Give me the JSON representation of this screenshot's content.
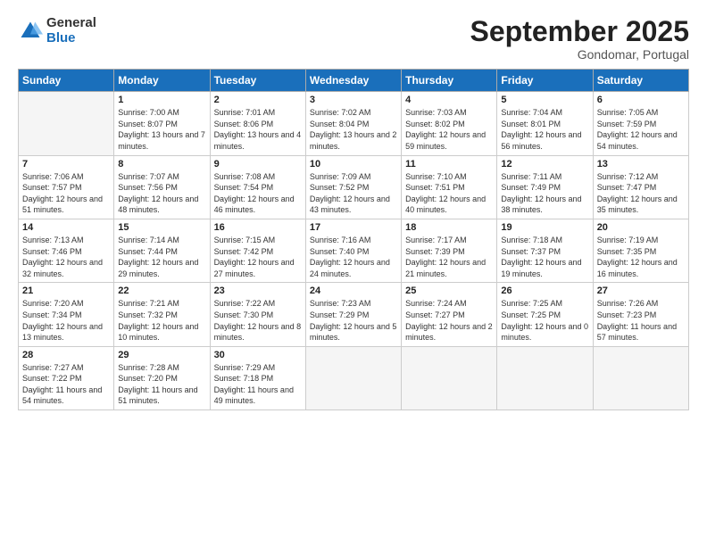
{
  "logo": {
    "general": "General",
    "blue": "Blue"
  },
  "title": "September 2025",
  "location": "Gondomar, Portugal",
  "days_of_week": [
    "Sunday",
    "Monday",
    "Tuesday",
    "Wednesday",
    "Thursday",
    "Friday",
    "Saturday"
  ],
  "weeks": [
    [
      {
        "day": "",
        "info": ""
      },
      {
        "day": "1",
        "info": "Sunrise: 7:00 AM\nSunset: 8:07 PM\nDaylight: 13 hours and 7 minutes."
      },
      {
        "day": "2",
        "info": "Sunrise: 7:01 AM\nSunset: 8:06 PM\nDaylight: 13 hours and 4 minutes."
      },
      {
        "day": "3",
        "info": "Sunrise: 7:02 AM\nSunset: 8:04 PM\nDaylight: 13 hours and 2 minutes."
      },
      {
        "day": "4",
        "info": "Sunrise: 7:03 AM\nSunset: 8:02 PM\nDaylight: 12 hours and 59 minutes."
      },
      {
        "day": "5",
        "info": "Sunrise: 7:04 AM\nSunset: 8:01 PM\nDaylight: 12 hours and 56 minutes."
      },
      {
        "day": "6",
        "info": "Sunrise: 7:05 AM\nSunset: 7:59 PM\nDaylight: 12 hours and 54 minutes."
      }
    ],
    [
      {
        "day": "7",
        "info": "Sunrise: 7:06 AM\nSunset: 7:57 PM\nDaylight: 12 hours and 51 minutes."
      },
      {
        "day": "8",
        "info": "Sunrise: 7:07 AM\nSunset: 7:56 PM\nDaylight: 12 hours and 48 minutes."
      },
      {
        "day": "9",
        "info": "Sunrise: 7:08 AM\nSunset: 7:54 PM\nDaylight: 12 hours and 46 minutes."
      },
      {
        "day": "10",
        "info": "Sunrise: 7:09 AM\nSunset: 7:52 PM\nDaylight: 12 hours and 43 minutes."
      },
      {
        "day": "11",
        "info": "Sunrise: 7:10 AM\nSunset: 7:51 PM\nDaylight: 12 hours and 40 minutes."
      },
      {
        "day": "12",
        "info": "Sunrise: 7:11 AM\nSunset: 7:49 PM\nDaylight: 12 hours and 38 minutes."
      },
      {
        "day": "13",
        "info": "Sunrise: 7:12 AM\nSunset: 7:47 PM\nDaylight: 12 hours and 35 minutes."
      }
    ],
    [
      {
        "day": "14",
        "info": "Sunrise: 7:13 AM\nSunset: 7:46 PM\nDaylight: 12 hours and 32 minutes."
      },
      {
        "day": "15",
        "info": "Sunrise: 7:14 AM\nSunset: 7:44 PM\nDaylight: 12 hours and 29 minutes."
      },
      {
        "day": "16",
        "info": "Sunrise: 7:15 AM\nSunset: 7:42 PM\nDaylight: 12 hours and 27 minutes."
      },
      {
        "day": "17",
        "info": "Sunrise: 7:16 AM\nSunset: 7:40 PM\nDaylight: 12 hours and 24 minutes."
      },
      {
        "day": "18",
        "info": "Sunrise: 7:17 AM\nSunset: 7:39 PM\nDaylight: 12 hours and 21 minutes."
      },
      {
        "day": "19",
        "info": "Sunrise: 7:18 AM\nSunset: 7:37 PM\nDaylight: 12 hours and 19 minutes."
      },
      {
        "day": "20",
        "info": "Sunrise: 7:19 AM\nSunset: 7:35 PM\nDaylight: 12 hours and 16 minutes."
      }
    ],
    [
      {
        "day": "21",
        "info": "Sunrise: 7:20 AM\nSunset: 7:34 PM\nDaylight: 12 hours and 13 minutes."
      },
      {
        "day": "22",
        "info": "Sunrise: 7:21 AM\nSunset: 7:32 PM\nDaylight: 12 hours and 10 minutes."
      },
      {
        "day": "23",
        "info": "Sunrise: 7:22 AM\nSunset: 7:30 PM\nDaylight: 12 hours and 8 minutes."
      },
      {
        "day": "24",
        "info": "Sunrise: 7:23 AM\nSunset: 7:29 PM\nDaylight: 12 hours and 5 minutes."
      },
      {
        "day": "25",
        "info": "Sunrise: 7:24 AM\nSunset: 7:27 PM\nDaylight: 12 hours and 2 minutes."
      },
      {
        "day": "26",
        "info": "Sunrise: 7:25 AM\nSunset: 7:25 PM\nDaylight: 12 hours and 0 minutes."
      },
      {
        "day": "27",
        "info": "Sunrise: 7:26 AM\nSunset: 7:23 PM\nDaylight: 11 hours and 57 minutes."
      }
    ],
    [
      {
        "day": "28",
        "info": "Sunrise: 7:27 AM\nSunset: 7:22 PM\nDaylight: 11 hours and 54 minutes."
      },
      {
        "day": "29",
        "info": "Sunrise: 7:28 AM\nSunset: 7:20 PM\nDaylight: 11 hours and 51 minutes."
      },
      {
        "day": "30",
        "info": "Sunrise: 7:29 AM\nSunset: 7:18 PM\nDaylight: 11 hours and 49 minutes."
      },
      {
        "day": "",
        "info": ""
      },
      {
        "day": "",
        "info": ""
      },
      {
        "day": "",
        "info": ""
      },
      {
        "day": "",
        "info": ""
      }
    ]
  ]
}
